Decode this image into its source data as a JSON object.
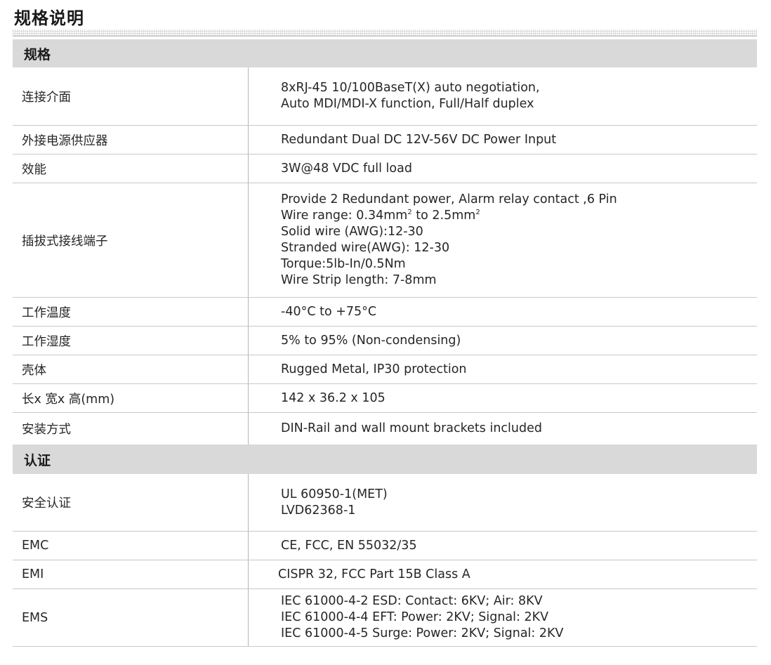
{
  "page_title": "规格说明",
  "sections": [
    {
      "title": "规格",
      "rows": [
        {
          "label": "连接介面",
          "lines": [
            "8xRJ-45 10/100BaseT(X) auto negotiation,",
            "Auto MDI/MDI-X function, Full/Half duplex"
          ]
        },
        {
          "label": "外接电源供应器",
          "lines": [
            "Redundant Dual DC 12V-56V DC Power Input"
          ]
        },
        {
          "label": "效能",
          "lines": [
            "3W@48 VDC full load"
          ]
        },
        {
          "label": "插拔式接线端子",
          "lines": [
            "Provide 2 Redundant power, Alarm relay contact ,6 Pin",
            "Wire range: 0.34mm² to 2.5mm²",
            "Solid wire (AWG):12-30",
            "Stranded wire(AWG): 12-30",
            "Torque:5lb-In/0.5Nm",
            "Wire Strip length: 7-8mm"
          ]
        },
        {
          "label": "工作温度",
          "lines": [
            "-40°C to +75°C"
          ]
        },
        {
          "label": "工作湿度",
          "lines": [
            "5% to 95% (Non-condensing)"
          ]
        },
        {
          "label": "壳体",
          "lines": [
            "Rugged Metal, IP30 protection"
          ]
        },
        {
          "label": "长x 宽x 高(mm)",
          "lines": [
            "142 x 36.2 x 105"
          ]
        },
        {
          "label": "安装方式",
          "lines": [
            "DIN-Rail and wall mount brackets included"
          ]
        }
      ]
    },
    {
      "title": "认证",
      "rows": [
        {
          "label": "安全认证",
          "lines": [
            "UL 60950-1(MET)",
            "LVD62368-1"
          ]
        },
        {
          "label": "EMC",
          "lines": [
            "CE, FCC, EN 55032/35"
          ]
        },
        {
          "label": "EMI",
          "lines": [
            "CISPR 32, FCC Part 15B Class A"
          ]
        },
        {
          "label": "EMS",
          "lines": [
            "IEC 61000-4-2 ESD: Contact: 6KV; Air: 8KV",
            "IEC 61000-4-4 EFT: Power: 2KV; Signal: 2KV",
            "IEC 61000-4-5 Surge: Power: 2KV; Signal: 2KV"
          ]
        }
      ]
    }
  ]
}
